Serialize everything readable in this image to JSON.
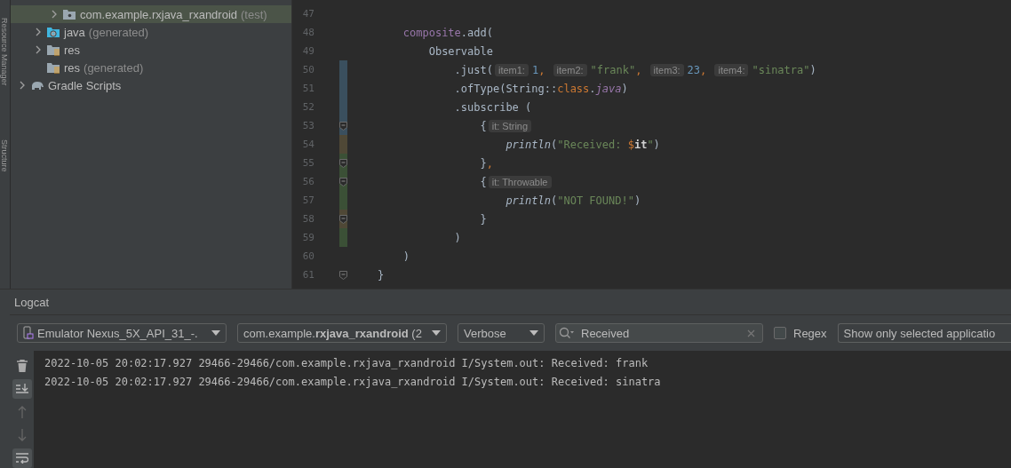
{
  "side_strip": {
    "labels": [
      "Resource Manager",
      "Structure"
    ]
  },
  "project_tree": [
    {
      "children": [
        {
          "children": [
            {
              "kind": "package",
              "label": "com.example.rxjava_rxandroid",
              "note": "(test)",
              "expanded": false,
              "selected": true
            }
          ]
        },
        {
          "kind": "java-generated",
          "label": "java",
          "note": "(generated)",
          "expanded": false,
          "selected": false
        },
        {
          "kind": "res",
          "label": "res",
          "expanded": false,
          "selected": false
        },
        {
          "kind": "res",
          "label": "res",
          "note": "(generated)",
          "selected": false
        }
      ]
    },
    {
      "kind": "gradle",
      "label": "Gradle Scripts",
      "expanded": false,
      "selected": false
    }
  ],
  "editor": {
    "lines": [
      {
        "number": "47"
      },
      {
        "number": "48",
        "segments": [
          {
            "kind": "field",
            "text": "        composite"
          },
          {
            "kind": "plain",
            "text": ".add("
          }
        ]
      },
      {
        "number": "49",
        "segments": [
          {
            "kind": "plain",
            "text": "            Observable"
          }
        ]
      },
      {
        "number": "50",
        "color": "#3a4f5e",
        "segments": [
          {
            "kind": "plain",
            "text": "                .just("
          },
          {
            "kind": "hint",
            "text": "item1:"
          },
          {
            "kind": "number",
            "text": "1"
          },
          {
            "kind": "keyword",
            "text": ", "
          },
          {
            "kind": "hint",
            "text": "item2:"
          },
          {
            "kind": "string",
            "text": "\"frank\""
          },
          {
            "kind": "keyword",
            "text": ", "
          },
          {
            "kind": "hint",
            "text": "item3:"
          },
          {
            "kind": "number",
            "text": "23"
          },
          {
            "kind": "keyword",
            "text": ", "
          },
          {
            "kind": "hint",
            "text": "item4:"
          },
          {
            "kind": "string",
            "text": "\"sinatra\""
          },
          {
            "kind": "plain",
            "text": ")"
          }
        ]
      },
      {
        "number": "51",
        "color": "#3a4f5e",
        "segments": [
          {
            "kind": "plain",
            "text": "                .ofType(String::"
          },
          {
            "kind": "keyword",
            "text": "class"
          },
          {
            "kind": "plain",
            "text": "."
          },
          {
            "kind": "ext",
            "text": "java"
          },
          {
            "kind": "plain",
            "text": ")"
          }
        ]
      },
      {
        "number": "52",
        "color": "#3a4f5e",
        "segments": [
          {
            "kind": "plain",
            "text": "                .subscribe ("
          }
        ]
      },
      {
        "number": "53",
        "color": "#3a4f5e",
        "fold": true,
        "segments": [
          {
            "kind": "plain",
            "text": "                    {"
          },
          {
            "kind": "hint",
            "text": "it: String"
          }
        ]
      },
      {
        "number": "54",
        "color": "#4f4836",
        "segments": [
          {
            "kind": "call",
            "text": "                        println"
          },
          {
            "kind": "plain",
            "text": "("
          },
          {
            "kind": "string",
            "text": "\"Received: "
          },
          {
            "kind": "keyword",
            "text": "$"
          },
          {
            "kind": "var",
            "text": "it"
          },
          {
            "kind": "string",
            "text": "\""
          },
          {
            "kind": "plain",
            "text": ")"
          }
        ]
      },
      {
        "number": "55",
        "color": "#3b5036",
        "fold": true,
        "segments": [
          {
            "kind": "plain",
            "text": "                    }"
          },
          {
            "kind": "keyword",
            "text": ","
          }
        ]
      },
      {
        "number": "56",
        "color": "#3b5036",
        "fold": true,
        "segments": [
          {
            "kind": "plain",
            "text": "                    {"
          },
          {
            "kind": "hint",
            "text": "it: Throwable"
          }
        ]
      },
      {
        "number": "57",
        "color": "#3b5036",
        "segments": [
          {
            "kind": "call",
            "text": "                        println"
          },
          {
            "kind": "plain",
            "text": "("
          },
          {
            "kind": "string",
            "text": "\"NOT FOUND!\""
          },
          {
            "kind": "plain",
            "text": ")"
          }
        ]
      },
      {
        "number": "58",
        "color": "#4f4836",
        "fold": true,
        "segments": [
          {
            "kind": "plain",
            "text": "                    }"
          }
        ]
      },
      {
        "number": "59",
        "color": "#3b5036",
        "segments": [
          {
            "kind": "plain",
            "text": "                )"
          }
        ]
      },
      {
        "number": "60",
        "segments": [
          {
            "kind": "plain",
            "text": "        )"
          }
        ]
      },
      {
        "number": "61",
        "fold": true,
        "segments": [
          {
            "kind": "plain",
            "text": "    }"
          }
        ]
      }
    ]
  },
  "logcat": {
    "title": "Logcat",
    "device": "Emulator Nexus_5X_API_31_-.",
    "process": "com.example.**rxjava_rxandroid** (2",
    "level": "Verbose",
    "search": {
      "value": "Received"
    },
    "regex": {
      "label": "Regex",
      "checked": false
    },
    "filter": "Show only selected applicatio",
    "tools": [
      {
        "kind": "trash",
        "on": false
      },
      {
        "kind": "scroll-end",
        "on": true
      },
      {
        "kind": "up",
        "on": false
      },
      {
        "kind": "down",
        "on": false
      },
      {
        "kind": "wrap",
        "on": true
      }
    ],
    "lines": [
      "2022-10-05 20:02:17.927 29466-29466/com.example.rxjava_rxandroid I/System.out: Received: frank",
      "2022-10-05 20:02:17.927 29466-29466/com.example.rxjava_rxandroid I/System.out: Received: sinatra"
    ]
  }
}
